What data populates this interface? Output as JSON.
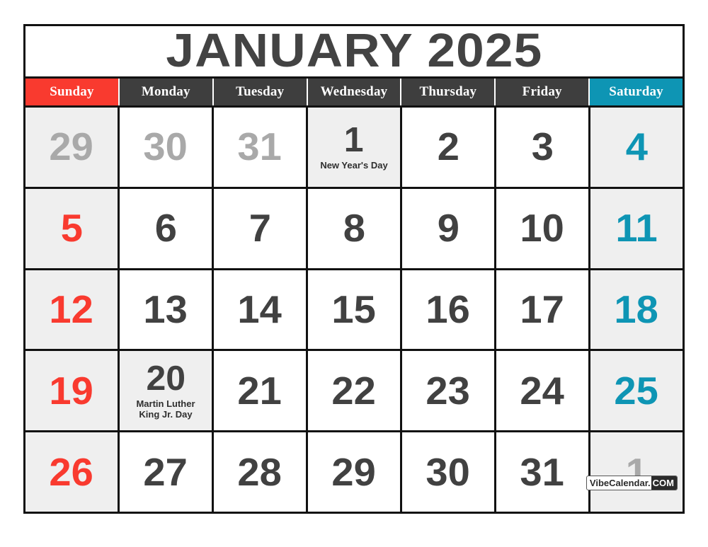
{
  "title": "JANUARY 2025",
  "colors": {
    "sunday_header": "#F93A2F",
    "saturday_header": "#0E95B4",
    "weekday_header": "#3E3E3E",
    "date_text": "#414141",
    "muted_date": "#A9A9A9",
    "shaded_cell": "#EFEFEF",
    "border": "#111111"
  },
  "weekdays": [
    {
      "label": "Sunday",
      "style": "sunday"
    },
    {
      "label": "Monday",
      "style": "weekday"
    },
    {
      "label": "Tuesday",
      "style": "weekday"
    },
    {
      "label": "Wednesday",
      "style": "weekday"
    },
    {
      "label": "Thursday",
      "style": "weekday"
    },
    {
      "label": "Friday",
      "style": "weekday"
    },
    {
      "label": "Saturday",
      "style": "saturday"
    }
  ],
  "weeks": [
    [
      {
        "day": "29",
        "kind": "muted",
        "shaded": true,
        "event": ""
      },
      {
        "day": "30",
        "kind": "muted",
        "shaded": false,
        "event": ""
      },
      {
        "day": "31",
        "kind": "muted",
        "shaded": false,
        "event": ""
      },
      {
        "day": "1",
        "kind": "normal",
        "shaded": true,
        "event": "New Year's Day"
      },
      {
        "day": "2",
        "kind": "normal",
        "shaded": false,
        "event": ""
      },
      {
        "day": "3",
        "kind": "normal",
        "shaded": false,
        "event": ""
      },
      {
        "day": "4",
        "kind": "sat",
        "shaded": true,
        "event": ""
      }
    ],
    [
      {
        "day": "5",
        "kind": "sun",
        "shaded": true,
        "event": ""
      },
      {
        "day": "6",
        "kind": "normal",
        "shaded": false,
        "event": ""
      },
      {
        "day": "7",
        "kind": "normal",
        "shaded": false,
        "event": ""
      },
      {
        "day": "8",
        "kind": "normal",
        "shaded": false,
        "event": ""
      },
      {
        "day": "9",
        "kind": "normal",
        "shaded": false,
        "event": ""
      },
      {
        "day": "10",
        "kind": "normal",
        "shaded": false,
        "event": ""
      },
      {
        "day": "11",
        "kind": "sat",
        "shaded": true,
        "event": ""
      }
    ],
    [
      {
        "day": "12",
        "kind": "sun",
        "shaded": true,
        "event": ""
      },
      {
        "day": "13",
        "kind": "normal",
        "shaded": false,
        "event": ""
      },
      {
        "day": "14",
        "kind": "normal",
        "shaded": false,
        "event": ""
      },
      {
        "day": "15",
        "kind": "normal",
        "shaded": false,
        "event": ""
      },
      {
        "day": "16",
        "kind": "normal",
        "shaded": false,
        "event": ""
      },
      {
        "day": "17",
        "kind": "normal",
        "shaded": false,
        "event": ""
      },
      {
        "day": "18",
        "kind": "sat",
        "shaded": true,
        "event": ""
      }
    ],
    [
      {
        "day": "19",
        "kind": "sun",
        "shaded": true,
        "event": ""
      },
      {
        "day": "20",
        "kind": "normal",
        "shaded": true,
        "event": "Martin Luther\nKing Jr. Day"
      },
      {
        "day": "21",
        "kind": "normal",
        "shaded": false,
        "event": ""
      },
      {
        "day": "22",
        "kind": "normal",
        "shaded": false,
        "event": ""
      },
      {
        "day": "23",
        "kind": "normal",
        "shaded": false,
        "event": ""
      },
      {
        "day": "24",
        "kind": "normal",
        "shaded": false,
        "event": ""
      },
      {
        "day": "25",
        "kind": "sat",
        "shaded": true,
        "event": ""
      }
    ],
    [
      {
        "day": "26",
        "kind": "sun",
        "shaded": true,
        "event": ""
      },
      {
        "day": "27",
        "kind": "normal",
        "shaded": false,
        "event": ""
      },
      {
        "day": "28",
        "kind": "normal",
        "shaded": false,
        "event": ""
      },
      {
        "day": "29",
        "kind": "normal",
        "shaded": false,
        "event": ""
      },
      {
        "day": "30",
        "kind": "normal",
        "shaded": false,
        "event": ""
      },
      {
        "day": "31",
        "kind": "normal",
        "shaded": false,
        "event": ""
      },
      {
        "day": "1",
        "kind": "muted",
        "shaded": true,
        "event": ""
      }
    ]
  ],
  "watermark": {
    "name": "VibeCalendar.",
    "tld": "COM"
  }
}
